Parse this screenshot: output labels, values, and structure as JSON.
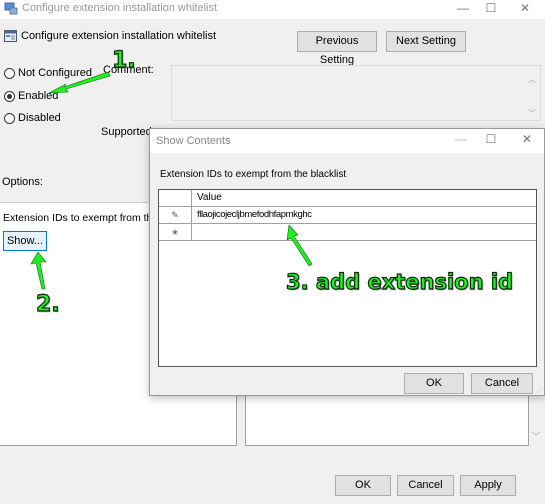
{
  "window": {
    "title": "Configure extension installation whitelist",
    "controls": {
      "minimize": "—",
      "maximize": "☐",
      "close": "✕"
    }
  },
  "header": {
    "title": "Configure extension installation whitelist",
    "previous_label": "Previous Setting",
    "next_label": "Next Setting"
  },
  "state": {
    "options": [
      {
        "label": "Not Configured",
        "checked": false
      },
      {
        "label": "Enabled",
        "checked": true
      },
      {
        "label": "Disabled",
        "checked": false
      }
    ]
  },
  "labels": {
    "comment": "Comment:",
    "supported": "Supported",
    "options": "Options:",
    "option_field": "Extension IDs to exempt from the b"
  },
  "show_button": "Show...",
  "footer": {
    "ok": "OK",
    "cancel": "Cancel",
    "apply": "Apply"
  },
  "dialog": {
    "title": "Show Contents",
    "controls": {
      "minimize": "—",
      "maximize": "☐",
      "close": "✕"
    },
    "description": "Extension IDs to exempt from the blacklist",
    "column_header": "Value",
    "rows": [
      {
        "marker": "✎",
        "value": "fllaojicojecljbmefodhfapmkghc"
      },
      {
        "marker": "∗",
        "value": ""
      }
    ],
    "ok": "OK",
    "cancel": "Cancel"
  },
  "annotations": {
    "step1": "1.",
    "step2": "2.",
    "step3": "3. add extension id",
    "color": "#22ee22"
  }
}
